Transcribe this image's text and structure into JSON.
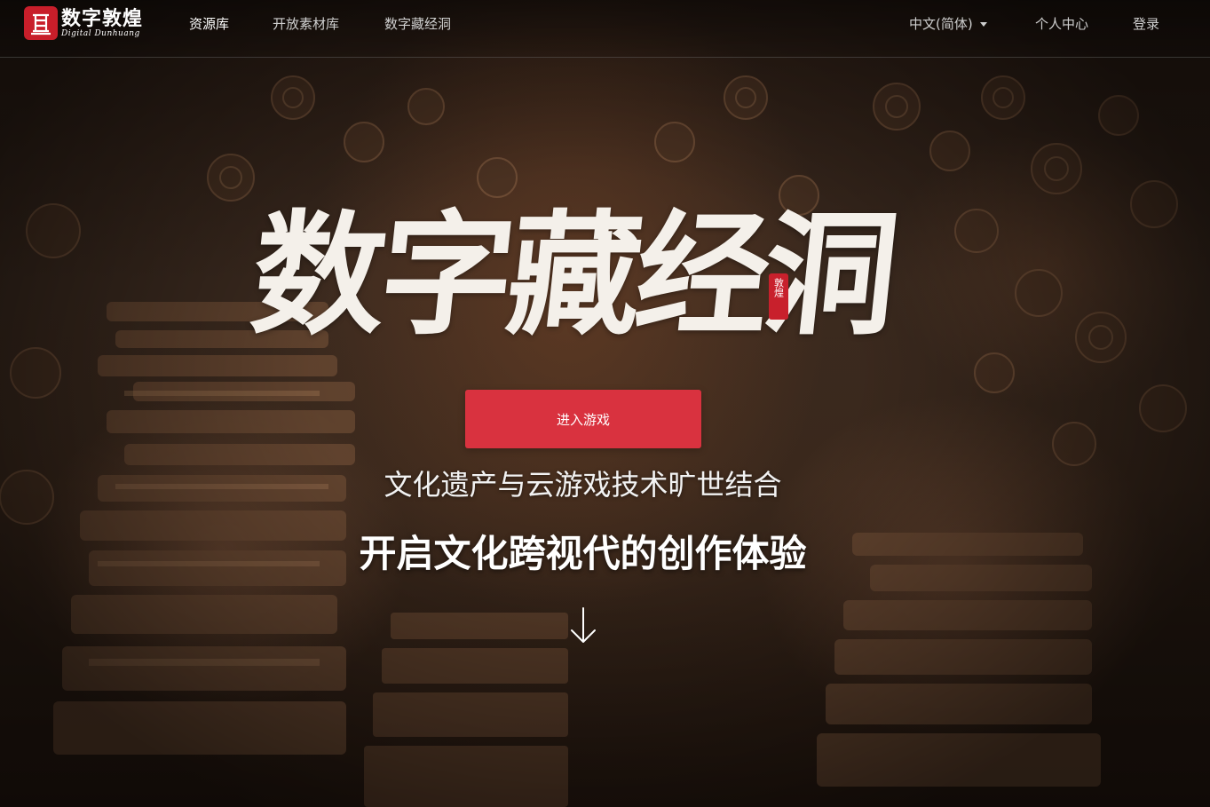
{
  "header": {
    "logo": {
      "title_cn": "数字敦煌",
      "title_en": "Digital Dunhuang"
    },
    "nav": [
      {
        "label": "资源库",
        "active": true
      },
      {
        "label": "开放素材库",
        "active": false
      },
      {
        "label": "数字藏经洞",
        "active": false
      }
    ],
    "language": "中文(简体)",
    "user_center": "个人中心",
    "login": "登录"
  },
  "hero": {
    "calligraphy_title": "数字藏经洞",
    "seal_text": "敦煌",
    "cta_label": "进入游戏",
    "subtitle": "文化遗产与云游戏技术旷世结合",
    "headline": "开启文化跨视代的创作体验"
  },
  "colors": {
    "accent_red": "#d9323f",
    "logo_red": "#c81e2a",
    "nav_text": "#cfcfcf",
    "nav_active": "#ffffff"
  },
  "icons": {
    "logo_seal": "cave-temple-seal-icon",
    "language_caret": "caret-down-icon",
    "scroll_down": "arrow-down-icon"
  }
}
